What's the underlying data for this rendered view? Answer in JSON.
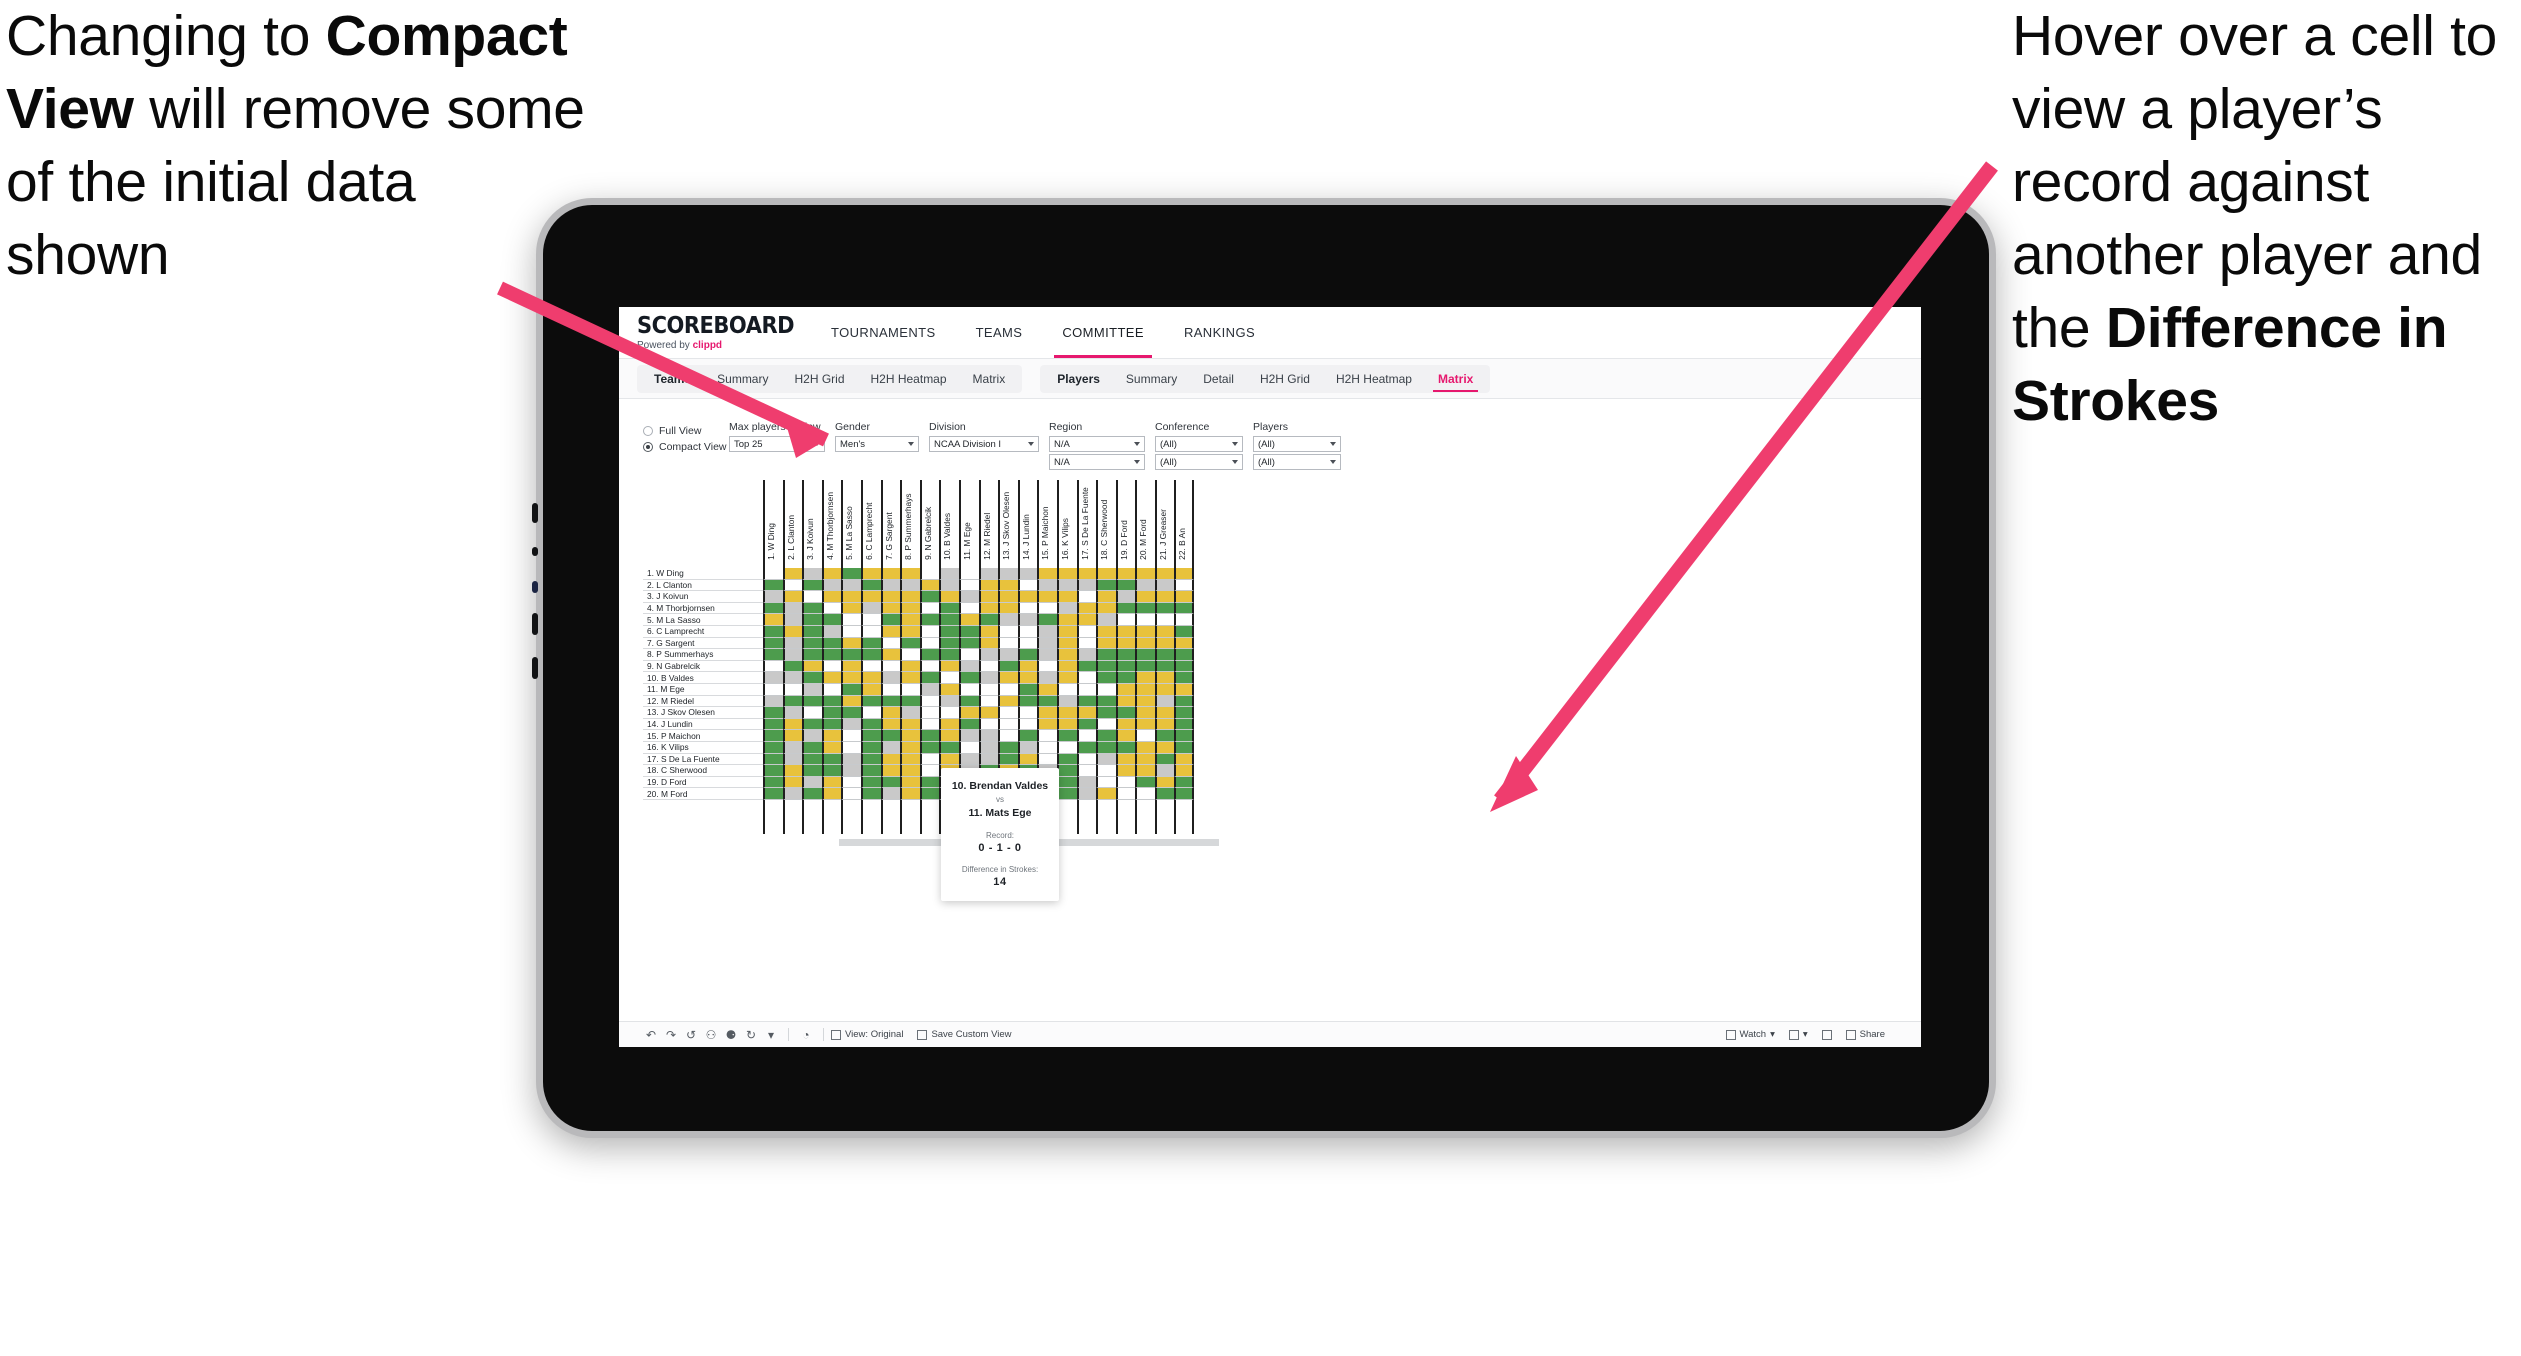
{
  "annotations": {
    "left": {
      "pre": "Changing to ",
      "bold": "Compact View",
      "post": " will remove some of the initial data shown"
    },
    "right": {
      "pre": "Hover over a cell to view a player’s record against another player and the ",
      "bold": "Difference in Strokes",
      "post": ""
    }
  },
  "app": {
    "brand": {
      "title": "SCOREBOARD",
      "powered_prefix": "Powered by ",
      "powered_name": "clippd"
    },
    "main_nav": [
      {
        "label": "TOURNAMENTS",
        "active": false
      },
      {
        "label": "TEAMS",
        "active": false
      },
      {
        "label": "COMMITTEE",
        "active": true
      },
      {
        "label": "RANKINGS",
        "active": false
      }
    ],
    "subtabs_group_1": [
      {
        "label": "Teams",
        "lead": true,
        "active": false
      },
      {
        "label": "Summary",
        "lead": false,
        "active": false
      },
      {
        "label": "H2H Grid",
        "lead": false,
        "active": false
      },
      {
        "label": "H2H Heatmap",
        "lead": false,
        "active": false
      },
      {
        "label": "Matrix",
        "lead": false,
        "active": false
      }
    ],
    "subtabs_group_2": [
      {
        "label": "Players",
        "lead": true,
        "active": false
      },
      {
        "label": "Summary",
        "lead": false,
        "active": false
      },
      {
        "label": "Detail",
        "lead": false,
        "active": false
      },
      {
        "label": "H2H Grid",
        "lead": false,
        "active": false
      },
      {
        "label": "H2H Heatmap",
        "lead": false,
        "active": false
      },
      {
        "label": "Matrix",
        "lead": false,
        "active": true
      }
    ],
    "accent_color": "#e6186e"
  },
  "filters": {
    "view_mode": [
      {
        "label": "Full View",
        "selected": false
      },
      {
        "label": "Compact View",
        "selected": true
      }
    ],
    "dropdowns": [
      {
        "label": "Max players in view",
        "value": "Top 25",
        "width_class": "w-max",
        "second": null
      },
      {
        "label": "Gender",
        "value": "Men's",
        "width_class": "w-gen",
        "second": null
      },
      {
        "label": "Division",
        "value": "NCAA Division I",
        "width_class": "w-div",
        "second": null
      },
      {
        "label": "Region",
        "value": "N/A",
        "width_class": "w-reg",
        "second": "N/A"
      },
      {
        "label": "Conference",
        "value": "(All)",
        "width_class": "w-con",
        "second": "(All)"
      },
      {
        "label": "Players",
        "value": "(All)",
        "width_class": "w-pla",
        "second": "(All)"
      }
    ]
  },
  "matrix": {
    "row_labels": [
      "1. W Ding",
      "2. L Clanton",
      "3. J Koivun",
      "4. M Thorbjornsen",
      "5. M La Sasso",
      "6. C Lamprecht",
      "7. G Sargent",
      "8. P Summerhays",
      "9. N Gabrelcik",
      "10. B Valdes",
      "11. M Ege",
      "12. M Riedel",
      "13. J Skov Olesen",
      "14. J Lundin",
      "15. P Maichon",
      "16. K Vilips",
      "17. S De La Fuente",
      "18. C Sherwood",
      "19. D Ford",
      "20. M Ford"
    ],
    "col_labels": [
      "1. W Ding",
      "2. L Clanton",
      "3. J Koivun",
      "4. M Thorbjornsen",
      "5. M La Sasso",
      "6. C Lamprecht",
      "7. G Sargent",
      "8. P Summerhays",
      "9. N Gabrelcik",
      "10. B Valdes",
      "11. M Ege",
      "12. M Riedel",
      "13. J Skov Olesen",
      "14. J Lundin",
      "15. P Maichon",
      "16. K Vilips",
      "17. S De La Fuente",
      "18. C Sherwood",
      "19. D Ford",
      "20. M Ford",
      "21. J Greaser",
      "22. B An"
    ],
    "legend_colors": {
      "win": "#4d9c4d",
      "tie": "#e8c23c",
      "loss": "#c9c9c9",
      "none": "#ffffff"
    },
    "cells": [
      [
        "w",
        "y",
        "a",
        "y",
        "g",
        "y",
        "y",
        "y",
        "w",
        "a",
        "w",
        "a",
        "a",
        "a",
        "y",
        "y",
        "y",
        "y",
        "y",
        "y",
        "y",
        "y"
      ],
      [
        "g",
        "w",
        "g",
        "a",
        "a",
        "g",
        "a",
        "a",
        "y",
        "a",
        "w",
        "y",
        "y",
        "w",
        "a",
        "a",
        "a",
        "g",
        "g",
        "a",
        "a",
        "w"
      ],
      [
        "a",
        "y",
        "w",
        "y",
        "y",
        "y",
        "y",
        "y",
        "g",
        "y",
        "a",
        "y",
        "y",
        "y",
        "y",
        "y",
        "w",
        "y",
        "a",
        "y",
        "y",
        "y"
      ],
      [
        "g",
        "a",
        "g",
        "w",
        "y",
        "a",
        "y",
        "y",
        "w",
        "g",
        "w",
        "y",
        "y",
        "w",
        "w",
        "a",
        "y",
        "y",
        "g",
        "g",
        "g",
        "g"
      ],
      [
        "y",
        "a",
        "g",
        "g",
        "w",
        "w",
        "g",
        "y",
        "g",
        "g",
        "y",
        "g",
        "a",
        "a",
        "g",
        "y",
        "y",
        "a",
        "w",
        "w",
        "w",
        "w"
      ],
      [
        "g",
        "y",
        "g",
        "a",
        "w",
        "w",
        "y",
        "y",
        "w",
        "g",
        "g",
        "y",
        "w",
        "w",
        "a",
        "y",
        "w",
        "y",
        "y",
        "y",
        "y",
        "g"
      ],
      [
        "g",
        "a",
        "g",
        "g",
        "y",
        "g",
        "w",
        "g",
        "w",
        "g",
        "g",
        "y",
        "w",
        "w",
        "a",
        "y",
        "w",
        "y",
        "y",
        "y",
        "y",
        "y"
      ],
      [
        "g",
        "a",
        "g",
        "g",
        "g",
        "g",
        "y",
        "w",
        "g",
        "g",
        "w",
        "a",
        "a",
        "g",
        "a",
        "y",
        "a",
        "g",
        "g",
        "g",
        "g",
        "g"
      ],
      [
        "w",
        "g",
        "y",
        "w",
        "y",
        "w",
        "w",
        "y",
        "w",
        "y",
        "a",
        "w",
        "g",
        "y",
        "w",
        "y",
        "g",
        "g",
        "g",
        "g",
        "g",
        "g"
      ],
      [
        "a",
        "a",
        "g",
        "y",
        "y",
        "y",
        "a",
        "y",
        "g",
        "w",
        "g",
        "a",
        "y",
        "y",
        "a",
        "y",
        "w",
        "g",
        "g",
        "y",
        "y",
        "g"
      ],
      [
        "w",
        "w",
        "a",
        "w",
        "g",
        "y",
        "w",
        "w",
        "a",
        "y",
        "w",
        "w",
        "w",
        "g",
        "y",
        "w",
        "w",
        "w",
        "y",
        "y",
        "y",
        "y"
      ],
      [
        "a",
        "g",
        "g",
        "g",
        "y",
        "g",
        "g",
        "g",
        "w",
        "a",
        "g",
        "w",
        "y",
        "g",
        "g",
        "a",
        "g",
        "g",
        "y",
        "y",
        "a",
        "g"
      ],
      [
        "g",
        "a",
        "w",
        "g",
        "g",
        "w",
        "y",
        "a",
        "w",
        "w",
        "y",
        "y",
        "w",
        "w",
        "y",
        "y",
        "y",
        "g",
        "g",
        "y",
        "y",
        "g"
      ],
      [
        "g",
        "y",
        "g",
        "g",
        "a",
        "g",
        "y",
        "y",
        "w",
        "y",
        "g",
        "w",
        "w",
        "w",
        "y",
        "y",
        "g",
        "w",
        "y",
        "y",
        "y",
        "g"
      ],
      [
        "g",
        "y",
        "a",
        "y",
        "w",
        "g",
        "g",
        "y",
        "g",
        "y",
        "a",
        "a",
        "w",
        "g",
        "w",
        "g",
        "w",
        "g",
        "y",
        "w",
        "g",
        "g"
      ],
      [
        "g",
        "a",
        "g",
        "y",
        "w",
        "g",
        "a",
        "y",
        "g",
        "g",
        "w",
        "a",
        "g",
        "a",
        "w",
        "w",
        "g",
        "g",
        "g",
        "y",
        "y",
        "g"
      ],
      [
        "g",
        "a",
        "g",
        "g",
        "a",
        "g",
        "y",
        "y",
        "w",
        "y",
        "a",
        "a",
        "g",
        "y",
        "w",
        "g",
        "w",
        "a",
        "y",
        "y",
        "g",
        "y"
      ],
      [
        "g",
        "y",
        "g",
        "g",
        "a",
        "g",
        "y",
        "y",
        "w",
        "y",
        "a",
        "g",
        "y",
        "g",
        "a",
        "g",
        "w",
        "w",
        "y",
        "y",
        "a",
        "y"
      ],
      [
        "g",
        "y",
        "a",
        "y",
        "w",
        "g",
        "g",
        "y",
        "g",
        "y",
        "w",
        "g",
        "g",
        "a",
        "w",
        "g",
        "a",
        "w",
        "w",
        "g",
        "y",
        "g"
      ],
      [
        "g",
        "a",
        "g",
        "y",
        "w",
        "g",
        "a",
        "y",
        "g",
        "y",
        "w",
        "g",
        "g",
        "a",
        "g",
        "g",
        "a",
        "y",
        "w",
        "w",
        "g",
        "g"
      ]
    ]
  },
  "tooltip": {
    "player_a": "10. Brendan Valdes",
    "vs": "vs",
    "player_b": "11. Mats Ege",
    "record_label": "Record:",
    "record_value": "0 - 1 - 0",
    "diff_label": "Difference in Strokes:",
    "diff_value": "14"
  },
  "toolbar": {
    "icons": [
      {
        "name": "undo-icon",
        "glyph": "↶"
      },
      {
        "name": "redo-icon",
        "glyph": "↷"
      },
      {
        "name": "revert-icon",
        "glyph": "↺"
      },
      {
        "name": "pause-icon",
        "glyph": "⚇"
      },
      {
        "name": "resume-icon",
        "glyph": "⚈"
      },
      {
        "name": "refresh-icon",
        "glyph": "↻"
      },
      {
        "name": "refresh-dropdown-caret-icon",
        "glyph": "▾"
      }
    ],
    "clock_icon": "◔",
    "items": [
      {
        "name": "view-original-button",
        "label": "View: Original",
        "icon": "layout-icon"
      },
      {
        "name": "save-custom-view-button",
        "label": "Save Custom View",
        "icon": "chart-icon"
      }
    ],
    "right_items": [
      {
        "name": "watch-button",
        "label": "Watch",
        "icon": "eye-icon",
        "caret": true
      },
      {
        "name": "download-button",
        "label": "",
        "icon": "download-icon",
        "caret": true
      },
      {
        "name": "fullscreen-button",
        "label": "",
        "icon": "fullscreen-icon",
        "caret": false
      },
      {
        "name": "share-button",
        "label": "Share",
        "icon": "share-icon",
        "caret": false
      }
    ]
  }
}
